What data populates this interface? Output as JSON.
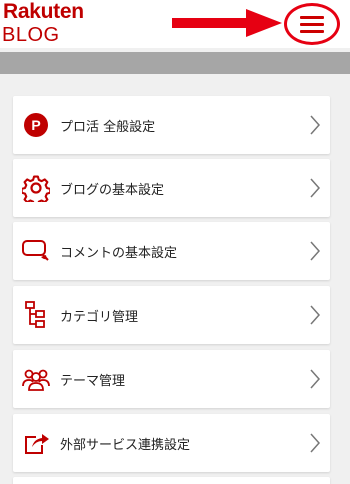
{
  "header": {
    "logo_top": "Rakuten",
    "logo_bottom": "BLOG"
  },
  "colors": {
    "brand_red": "#bf0000",
    "annotation_red": "#e60012",
    "card_bg": "#ffffff",
    "page_bg": "#f0f0f0"
  },
  "menu": {
    "items": [
      {
        "label": "プロ活 全般設定",
        "icon": "pro-katsu-p-icon"
      },
      {
        "label": "ブログの基本設定",
        "icon": "gear-icon"
      },
      {
        "label": "コメントの基本設定",
        "icon": "comment-bubble-icon"
      },
      {
        "label": "カテゴリ管理",
        "icon": "category-tree-icon"
      },
      {
        "label": "テーマ管理",
        "icon": "people-group-icon"
      },
      {
        "label": "外部サービス連携設定",
        "icon": "share-arrow-icon"
      }
    ]
  }
}
